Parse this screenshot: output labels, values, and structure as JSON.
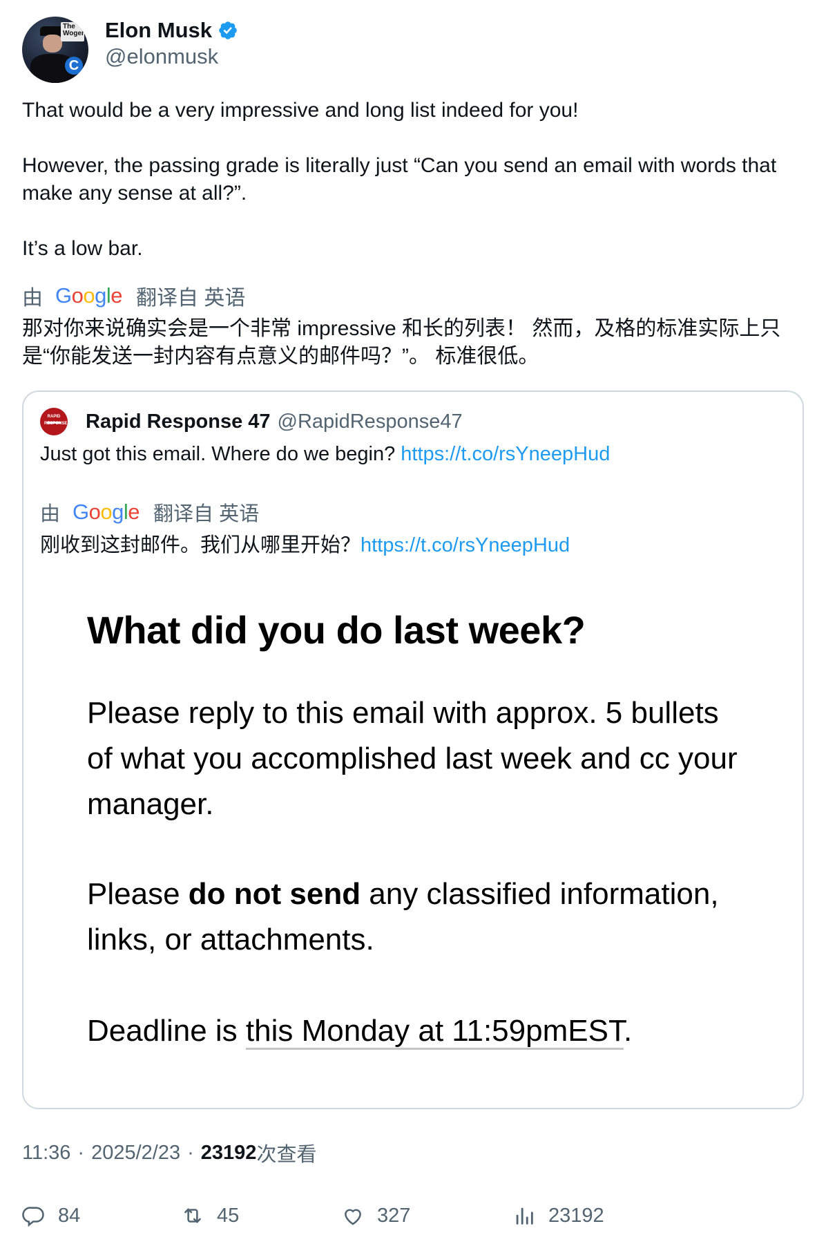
{
  "author": {
    "display_name": "Elon Musk",
    "handle": "@elonmusk",
    "avatar_sign_text": "The Wogera"
  },
  "tweet": {
    "paragraphs": [
      "That would be a very impressive and long list indeed for you!",
      "However, the passing grade is literally just “Can you send an email with words that make any sense at all?”.",
      "It’s a low bar."
    ]
  },
  "translation": {
    "by_label": "由",
    "google_label": "Google",
    "from_label": "翻译自 英语",
    "text": "那对你来说确实会是一个非常 impressive 和长的列表！ 然而，及格的标准实际上只是“你能发送一封内容有点意义的邮件吗？”。 标准很低。"
  },
  "quote": {
    "display_name": "Rapid Response 47",
    "handle": "@RapidResponse47",
    "text": "Just got this email. Where do we begin?",
    "link": "https://t.co/rsYneepHud",
    "translation": {
      "by_label": "由",
      "google_label": "Google",
      "from_label": "翻译自 英语",
      "text": "刚收到这封邮件。我们从哪里开始？",
      "link": "https://t.co/rsYneepHud"
    },
    "image": {
      "heading": "What did you do last week?",
      "p1": "Please reply to this email with approx. 5 bullets of what you accomplished last week and cc your manager.",
      "p2_before": "Please ",
      "p2_bold": "do not send",
      "p2_after": " any classified information, links, or attachments.",
      "p3_before": "Deadline is ",
      "p3_underlined": "this Monday at 11:59pmEST",
      "p3_after": "."
    }
  },
  "meta": {
    "time": "11:36",
    "date": "2025/2/23",
    "views_count": "23192",
    "views_label": "次查看"
  },
  "actions": {
    "replies": "84",
    "reposts": "45",
    "likes": "327",
    "views": "23192"
  },
  "colors": {
    "text": "#0f1419",
    "secondary": "#536471",
    "link": "#1d9bf0",
    "border": "#cfd9de",
    "verified": "#1d9bf0"
  },
  "icons": [
    "verified-badge-icon",
    "reply-icon",
    "repost-icon",
    "like-icon",
    "views-icon"
  ]
}
